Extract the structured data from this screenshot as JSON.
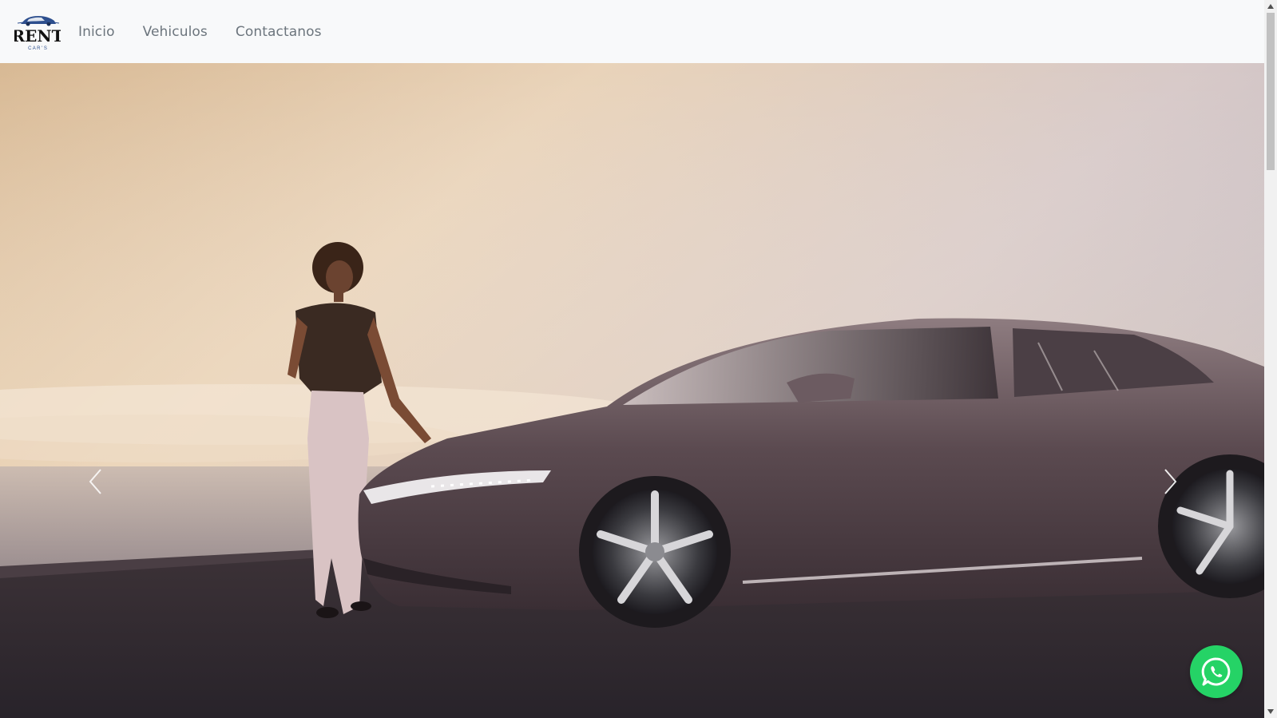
{
  "brand": {
    "logo_text": "RENT",
    "logo_subtext": "C A R ' S"
  },
  "nav": {
    "items": [
      {
        "label": "Inicio"
      },
      {
        "label": "Vehiculos"
      },
      {
        "label": "Contactanos"
      }
    ]
  },
  "hero": {
    "prev_icon": "chevron-left-icon",
    "next_icon": "chevron-right-icon"
  },
  "whatsapp": {
    "icon": "whatsapp-icon",
    "color": "#25d366"
  },
  "colors": {
    "navbar_bg": "#f8f9fa",
    "nav_link": "#6c757d"
  }
}
